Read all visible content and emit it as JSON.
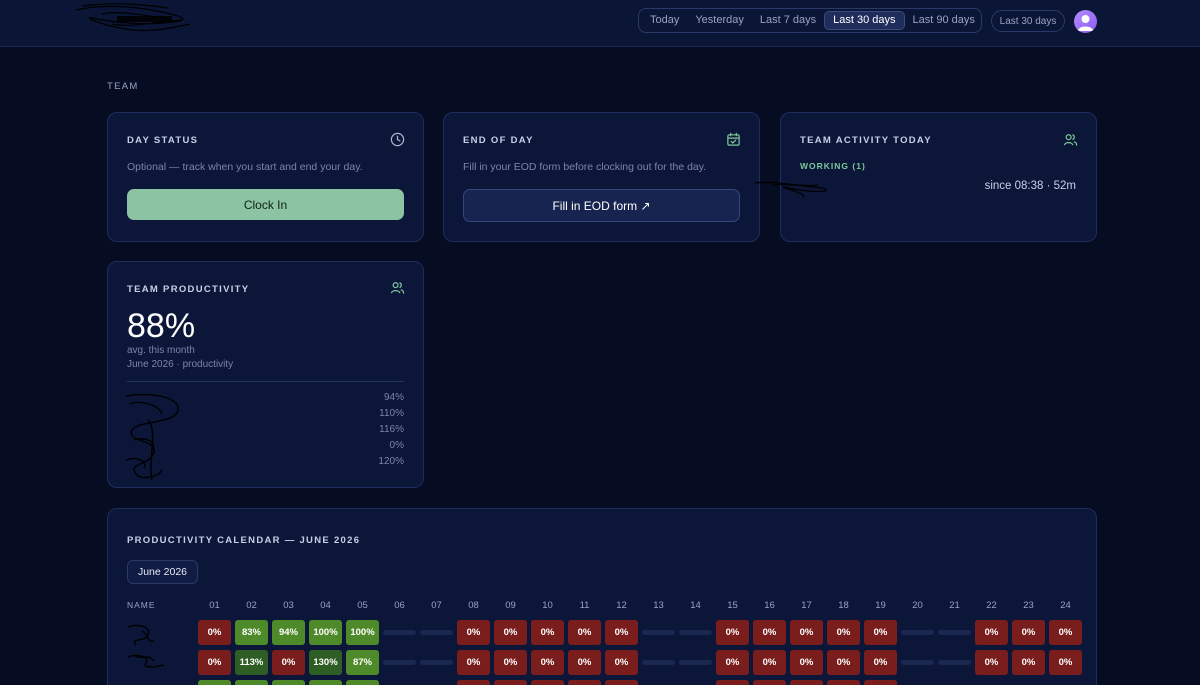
{
  "header": {
    "ranges": [
      "Today",
      "Yesterday",
      "Last 7 days",
      "Last 30 days",
      "Last 90 days"
    ],
    "active_range": "Last 30 days",
    "range_pill": "Last 30 days"
  },
  "section_label": "TEAM",
  "day_status": {
    "title": "DAY STATUS",
    "subtitle": "Optional — track when you start and end your day.",
    "button": "Clock In"
  },
  "end_of_day": {
    "title": "END OF DAY",
    "subtitle": "Fill in your EOD form before clocking out for the day.",
    "button": "Fill in EOD form ↗"
  },
  "team_activity": {
    "title": "TEAM ACTIVITY TODAY",
    "working_label": "WORKING (1)",
    "since": "since 08:38 · 52m"
  },
  "team_productivity": {
    "title": "TEAM PRODUCTIVITY",
    "value": "88%",
    "avg_label": "avg. this month",
    "period": "June 2026 · productivity",
    "members": [
      {
        "value": "94%"
      },
      {
        "value": "110%"
      },
      {
        "value": "116%"
      },
      {
        "value": "0%"
      },
      {
        "value": "120%"
      }
    ]
  },
  "calendar": {
    "title": "PRODUCTIVITY CALENDAR — JUNE 2026",
    "month_button": "June 2026",
    "name_header": "NAME",
    "days": [
      "01",
      "02",
      "03",
      "04",
      "05",
      "06",
      "07",
      "08",
      "09",
      "10",
      "11",
      "12",
      "13",
      "14",
      "15",
      "16",
      "17",
      "18",
      "19",
      "20",
      "21",
      "22",
      "23",
      "24"
    ],
    "rows": [
      {
        "cells": [
          "0%",
          "83%",
          "94%",
          "100%",
          "100%",
          "",
          "",
          "0%",
          "0%",
          "0%",
          "0%",
          "0%",
          "",
          "",
          "0%",
          "0%",
          "0%",
          "0%",
          "0%",
          "",
          "",
          "0%",
          "0%",
          "0%"
        ]
      },
      {
        "cells": [
          "0%",
          "113%",
          "0%",
          "130%",
          "87%",
          "",
          "",
          "0%",
          "0%",
          "0%",
          "0%",
          "0%",
          "",
          "",
          "0%",
          "0%",
          "0%",
          "0%",
          "0%",
          "",
          "",
          "0%",
          "0%",
          "0%"
        ]
      }
    ]
  }
}
